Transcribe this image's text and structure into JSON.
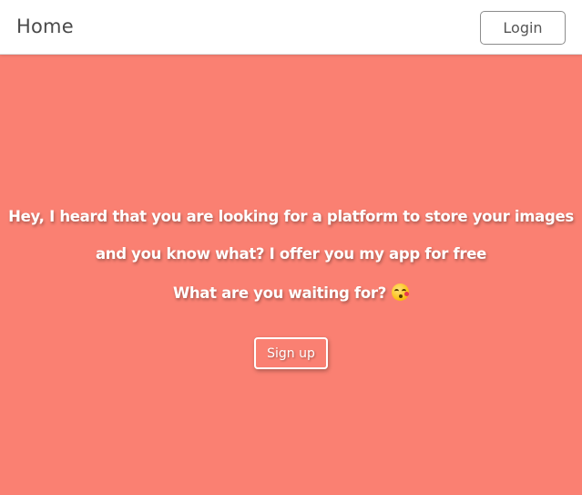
{
  "header": {
    "home_label": "Home",
    "login_label": "Login"
  },
  "hero": {
    "line1": "Hey, I heard that you are looking for a platform to store your images",
    "line2": "and you know what? I offer you my app for free",
    "line3": "What are you waiting for?",
    "line3_emoji": "kissing-face-icon",
    "signup_label": "Sign up"
  },
  "colors": {
    "hero_background": "#fa8072",
    "header_background": "#ffffff",
    "text_on_hero": "#ffffff",
    "home_text": "#4a4a4a"
  }
}
